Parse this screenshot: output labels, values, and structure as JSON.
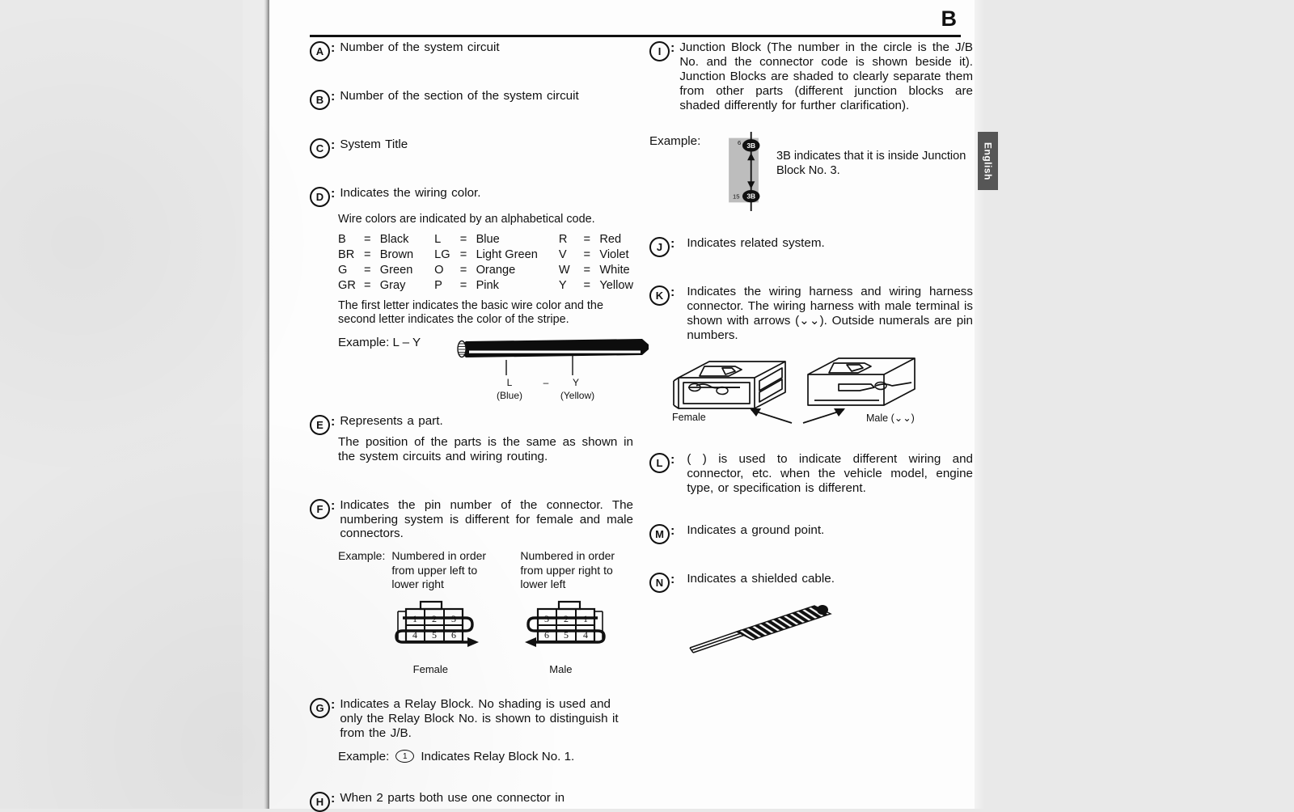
{
  "page": {
    "letter": "B",
    "thumb_tab": "English"
  },
  "legend_left": [
    {
      "key": "A",
      "text": "Number of the system circuit"
    },
    {
      "key": "B",
      "text": "Number of the section  of the system circuit"
    },
    {
      "key": "C",
      "text": "System Title"
    },
    {
      "key": "D",
      "text": "Indicates the wiring color.",
      "sub": "Wire colors are indicated by an alphabetical code.",
      "color_table": [
        [
          {
            "code": "B",
            "name": "Black"
          },
          {
            "code": "L",
            "name": "Blue"
          },
          {
            "code": "R",
            "name": "Red"
          }
        ],
        [
          {
            "code": "BR",
            "name": "Brown"
          },
          {
            "code": "LG",
            "name": "Light Green"
          },
          {
            "code": "V",
            "name": "Violet"
          }
        ],
        [
          {
            "code": "G",
            "name": "Green"
          },
          {
            "code": "O",
            "name": "Orange"
          },
          {
            "code": "W",
            "name": "White"
          }
        ],
        [
          {
            "code": "GR",
            "name": "Gray"
          },
          {
            "code": "P",
            "name": "Pink"
          },
          {
            "code": "Y",
            "name": "Yellow"
          }
        ]
      ],
      "note": "The first letter indicates the basic wire color and the second letter indicates the color of the stripe.",
      "example_label": "Example:  L – Y",
      "wire_labels": {
        "left_code": "L",
        "dash": "–",
        "right_code": "Y",
        "left_name": "(Blue)",
        "right_name": "(Yellow)"
      }
    },
    {
      "key": "E",
      "text": "Represents a part.",
      "sub": "The position of the parts is the same as shown in the system circuits and wiring routing."
    },
    {
      "key": "F",
      "text": "Indicates the pin number of the connector. The numbering system is different for female and male connectors.",
      "example_label": "Example:",
      "pin_columns": [
        {
          "description": "Numbered in order from upper left to lower right",
          "top_row": [
            "1",
            "2",
            "3"
          ],
          "bottom_row": [
            "4",
            "5",
            "6"
          ],
          "caption": "Female"
        },
        {
          "description": "Numbered in order from upper right to lower left",
          "top_row": [
            "3",
            "2",
            "1"
          ],
          "bottom_row": [
            "6",
            "5",
            "4"
          ],
          "caption": "Male"
        }
      ]
    },
    {
      "key": "G",
      "text": "Indicates a Relay Block. No shading is used and only the Relay Block No. is shown to distinguish it from the J/B.",
      "example_label": "Example:",
      "example_symbol": "1",
      "example_text": "Indicates Relay Block No. 1."
    },
    {
      "key": "H",
      "text": "When  2  parts  both  use  one  connector  in"
    }
  ],
  "legend_right": [
    {
      "key": "I",
      "text": "Junction Block (The number in the circle is the J/B No. and the connector code is shown beside it). Junction Blocks are shaded to clearly separate them from other parts (different junction blocks are shaded differently for further clarification).",
      "example_label": "Example:",
      "jb_diagram": {
        "top_pin": "6",
        "top_code": "3B",
        "bottom_pin": "15",
        "bottom_code": "3B"
      },
      "jb_note": "3B indicates that it is inside Junction Block No. 3."
    },
    {
      "key": "J",
      "text": "Indicates related system."
    },
    {
      "key": "K",
      "text": "Indicates the wiring harness and wiring harness connector. The wiring harness with male terminal is shown with arrows (⌄⌄). Outside numerals are pin numbers.",
      "figure_labels": {
        "female": "Female",
        "male": "Male (⌄⌄)"
      }
    },
    {
      "key": "L",
      "text": "(       ) is used to indicate different wiring and connector, etc. when the vehicle model, engine type, or specification is different."
    },
    {
      "key": "M",
      "text": "Indicates a ground point."
    },
    {
      "key": "N",
      "text": "Indicates a shielded cable."
    }
  ]
}
